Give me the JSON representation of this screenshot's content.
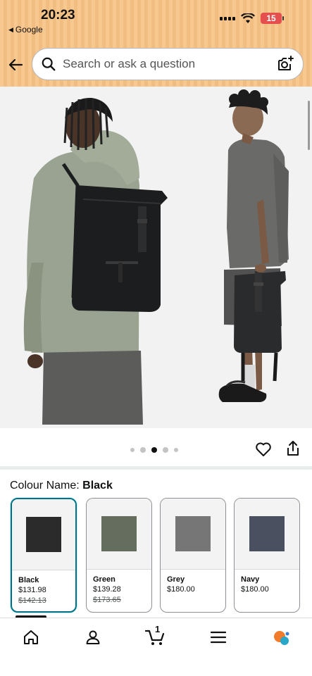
{
  "status_bar": {
    "time": "20:23",
    "back_app": "Google",
    "battery": "15"
  },
  "search": {
    "placeholder": "Search or ask a question"
  },
  "gallery": {
    "image_count": 5,
    "active_index": 2
  },
  "colour": {
    "label": "Colour Name:",
    "selected": "Black"
  },
  "swatches": [
    {
      "name": "Black",
      "price": "$131.98",
      "was": "$142.13",
      "color": "#2b2b2b",
      "selected": true
    },
    {
      "name": "Green",
      "price": "$139.28",
      "was": "$173.65",
      "color": "#656d5e",
      "selected": false
    },
    {
      "name": "Grey",
      "price": "$180.00",
      "was": "",
      "color": "#767676",
      "selected": false
    },
    {
      "name": "Navy",
      "price": "$180.00",
      "was": "",
      "color": "#4a5060",
      "selected": false
    }
  ],
  "bottom_nav": {
    "cart_count": "1",
    "items": [
      "home-icon",
      "account-icon",
      "cart-icon",
      "menu-icon",
      "rufus-icon"
    ]
  },
  "colors": {
    "header": "#f7c990",
    "selected_border": "#007185"
  }
}
